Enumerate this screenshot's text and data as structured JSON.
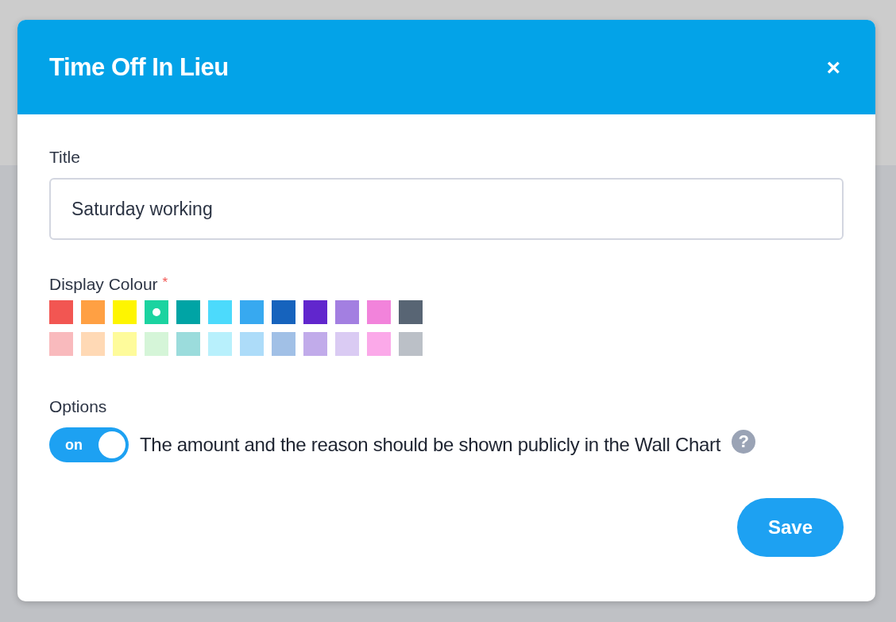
{
  "dialog": {
    "title": "Time Off In Lieu",
    "close": "×"
  },
  "title_field": {
    "label": "Title",
    "value": "Saturday working"
  },
  "colour": {
    "label": "Display Colour",
    "required_mark": "*",
    "swatches": [
      {
        "color": "#f25652",
        "selected": false
      },
      {
        "color": "#ffa043",
        "selected": false
      },
      {
        "color": "#fef500",
        "selected": false
      },
      {
        "color": "#1bd3a0",
        "selected": true
      },
      {
        "color": "#00a4a5",
        "selected": false
      },
      {
        "color": "#4cdafc",
        "selected": false
      },
      {
        "color": "#37a9f0",
        "selected": false
      },
      {
        "color": "#1663bd",
        "selected": false
      },
      {
        "color": "#6126cd",
        "selected": false
      },
      {
        "color": "#a37fe1",
        "selected": false
      },
      {
        "color": "#f283db",
        "selected": false
      },
      {
        "color": "#586574",
        "selected": false
      },
      {
        "color": "#f9babd",
        "selected": false
      },
      {
        "color": "#ffd9b5",
        "selected": false
      },
      {
        "color": "#fefb9b",
        "selected": false
      },
      {
        "color": "#d5f5d8",
        "selected": false
      },
      {
        "color": "#9bdcdc",
        "selected": false
      },
      {
        "color": "#b8f0fc",
        "selected": false
      },
      {
        "color": "#addcf9",
        "selected": false
      },
      {
        "color": "#a1c0e6",
        "selected": false
      },
      {
        "color": "#c1abea",
        "selected": false
      },
      {
        "color": "#dacbf3",
        "selected": false
      },
      {
        "color": "#fba9e9",
        "selected": false
      },
      {
        "color": "#bbc0c7",
        "selected": false
      }
    ]
  },
  "options": {
    "label": "Options",
    "toggle": {
      "label": "on",
      "on": true
    },
    "text": "The amount and the reason should be shown publicly in the Wall Chart",
    "help": "?"
  },
  "save": "Save"
}
